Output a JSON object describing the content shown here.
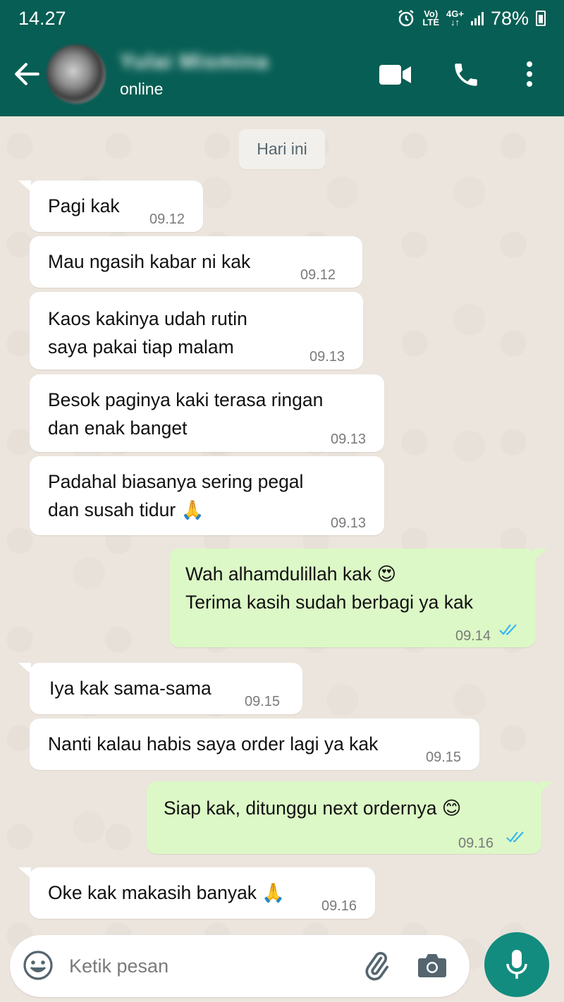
{
  "status_bar": {
    "time": "14.27",
    "volte_top": "Vo)",
    "volte_bottom": "LTE",
    "network_top": "4G+",
    "network_bottom": "↓↑",
    "battery": "78%"
  },
  "header": {
    "status": "online",
    "contact_name_blurred": "Yulai Mismina"
  },
  "chat": {
    "date_chip": "Hari ini",
    "messages": [
      {
        "direction": "in",
        "text": "Pagi kak",
        "time": "09.12"
      },
      {
        "direction": "in",
        "text": "Mau ngasih kabar ni kak",
        "time": "09.12"
      },
      {
        "direction": "in",
        "text": "Kaos kakinya udah rutin\nsaya pakai tiap malam",
        "time": "09.13"
      },
      {
        "direction": "in",
        "text": "Besok paginya kaki terasa ringan\ndan enak banget",
        "time": "09.13"
      },
      {
        "direction": "in",
        "text": "Padahal biasanya sering pegal\ndan susah tidur 🙏",
        "time": "09.13"
      },
      {
        "direction": "out",
        "text": "Wah alhamdulillah kak 😍\nTerima kasih sudah berbagi ya kak",
        "time": "09.14",
        "status": "read"
      },
      {
        "direction": "in",
        "text": "Iya kak sama-sama",
        "time": "09.15"
      },
      {
        "direction": "in",
        "text": "Nanti kalau habis saya order lagi ya kak",
        "time": "09.15"
      },
      {
        "direction": "out",
        "text": "Siap kak, ditunggu next ordernya 😊",
        "time": "09.16",
        "status": "read"
      },
      {
        "direction": "in",
        "text": "Oke kak makasih banyak 🙏",
        "time": "09.16"
      }
    ]
  },
  "input": {
    "placeholder": "Ketik pesan"
  },
  "colors": {
    "header": "#075e54",
    "incoming": "#ffffff",
    "outgoing": "#dcf8c6",
    "mic": "#128c7e",
    "read_tick": "#34b7f1"
  },
  "icons": [
    "back-arrow-icon",
    "video-call-icon",
    "voice-call-icon",
    "more-options-icon",
    "emoji-icon",
    "attach-icon",
    "camera-icon",
    "mic-icon",
    "read-tick-icon",
    "alarm-icon",
    "signal-icon",
    "battery-icon"
  ]
}
